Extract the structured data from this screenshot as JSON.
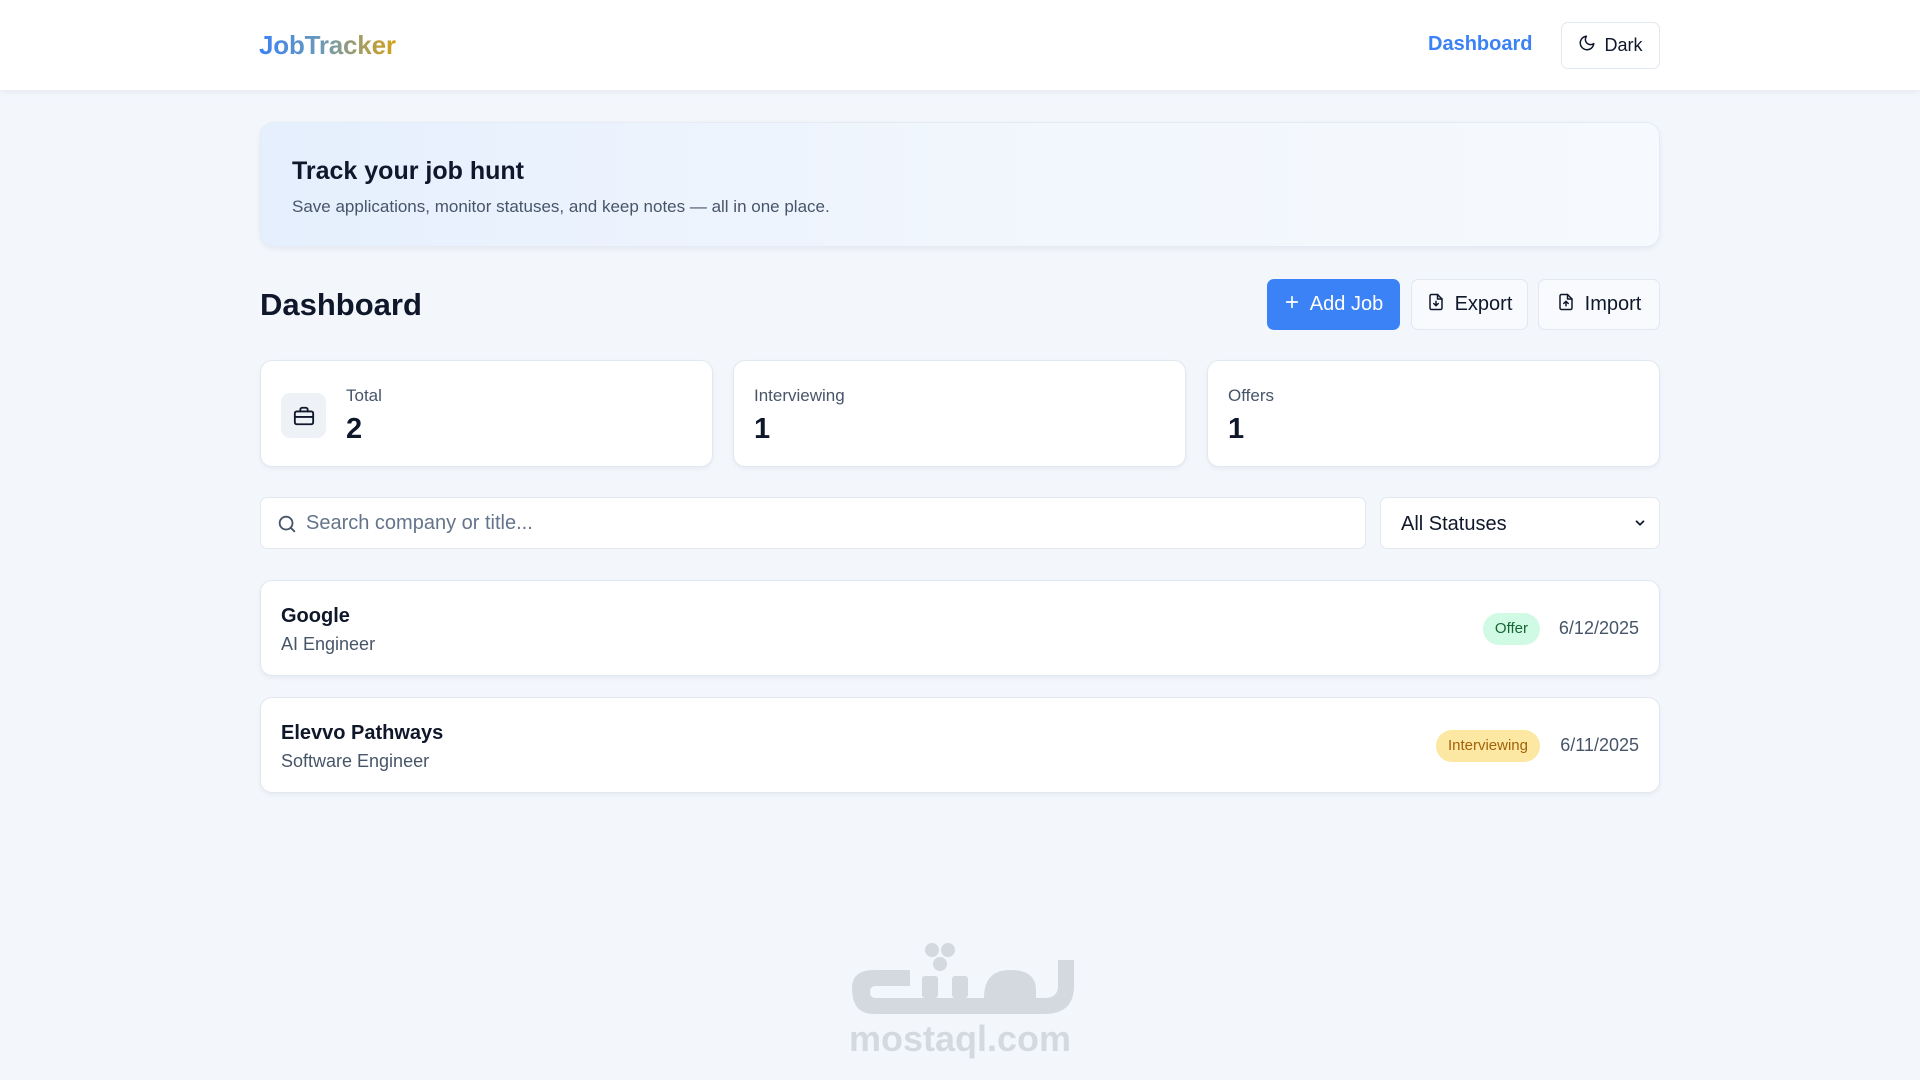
{
  "header": {
    "brand": "JobTracker",
    "nav_dashboard": "Dashboard",
    "theme_toggle": "Dark"
  },
  "hero": {
    "title": "Track your job hunt",
    "subtitle": "Save applications, monitor statuses, and keep notes — all in one place."
  },
  "dashboard": {
    "title": "Dashboard",
    "actions": {
      "add": "Add Job",
      "export": "Export",
      "import": "Import"
    }
  },
  "stats": [
    {
      "label": "Total",
      "value": "2",
      "icon": "briefcase-icon"
    },
    {
      "label": "Interviewing",
      "value": "1"
    },
    {
      "label": "Offers",
      "value": "1"
    }
  ],
  "search": {
    "placeholder": "Search company or title...",
    "value": ""
  },
  "filter": {
    "selected": "All Statuses"
  },
  "jobs": [
    {
      "company": "Google",
      "title": "AI Engineer",
      "status": "Offer",
      "date": "6/12/2025"
    },
    {
      "company": "Elevvo Pathways",
      "title": "Software Engineer",
      "status": "Interviewing",
      "date": "6/11/2025"
    }
  ],
  "watermark": {
    "logo_text": "مستقل",
    "domain": "mostaql.com"
  },
  "colors": {
    "accent": "#3b82f6",
    "offer_bg": "#d1fae5",
    "offer_text": "#166534",
    "interviewing_bg": "#fde8a3",
    "interviewing_text": "#a16207",
    "page_bg": "#f3f7fc"
  }
}
